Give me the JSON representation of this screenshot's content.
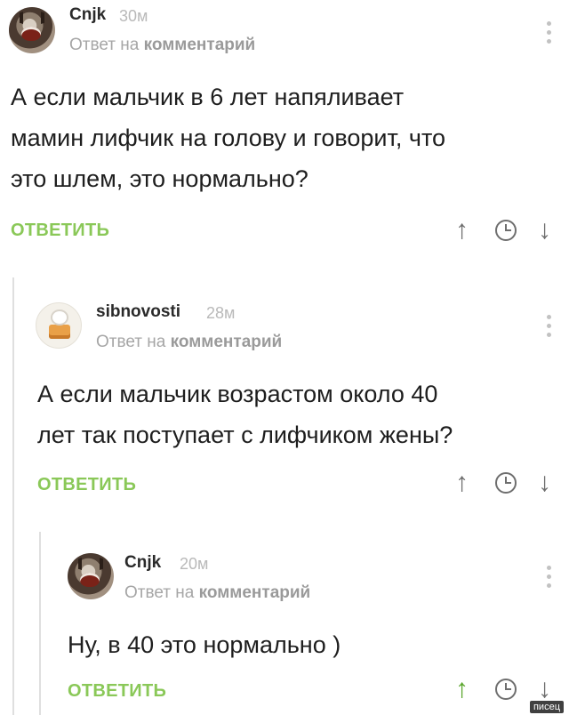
{
  "comments": [
    {
      "username": "Cnjk",
      "time": "30м",
      "reply_prefix": "Ответ на",
      "reply_target": "комментарий",
      "text_lines": [
        "А если мальчик в 6 лет напяливает",
        "мамин лифчик на голову и говорит, что",
        "это шлем, это нормально?"
      ],
      "reply_label": "ОТВЕТИТЬ",
      "avatar_icon": "cat-avatar",
      "upvoted": false
    },
    {
      "username": "sibnovosti",
      "time": "28м",
      "reply_prefix": "Ответ на",
      "reply_target": "комментарий",
      "text_lines": [
        "А если мальчик возрастом около 40",
        "лет так поступает с лифчиком жены?"
      ],
      "reply_label": "ОТВЕТИТЬ",
      "avatar_icon": "house-avatar",
      "upvoted": false
    },
    {
      "username": "Cnjk",
      "time": "20м",
      "reply_prefix": "Ответ на",
      "reply_target": "комментарий",
      "text_lines": [
        "Ну, в 40 это нормально )"
      ],
      "reply_label": "ОТВЕТИТЬ",
      "avatar_icon": "cat-avatar",
      "upvoted": true
    }
  ],
  "icons": {
    "upvote": "arrow-up-icon",
    "save": "clock-icon",
    "downvote": "arrow-down-icon",
    "menu": "more-vertical-icon"
  },
  "colors": {
    "reply_green": "#8ac858",
    "upvote_active": "#5aa62d",
    "muted": "#a6a6a6"
  },
  "watermark": "писец"
}
